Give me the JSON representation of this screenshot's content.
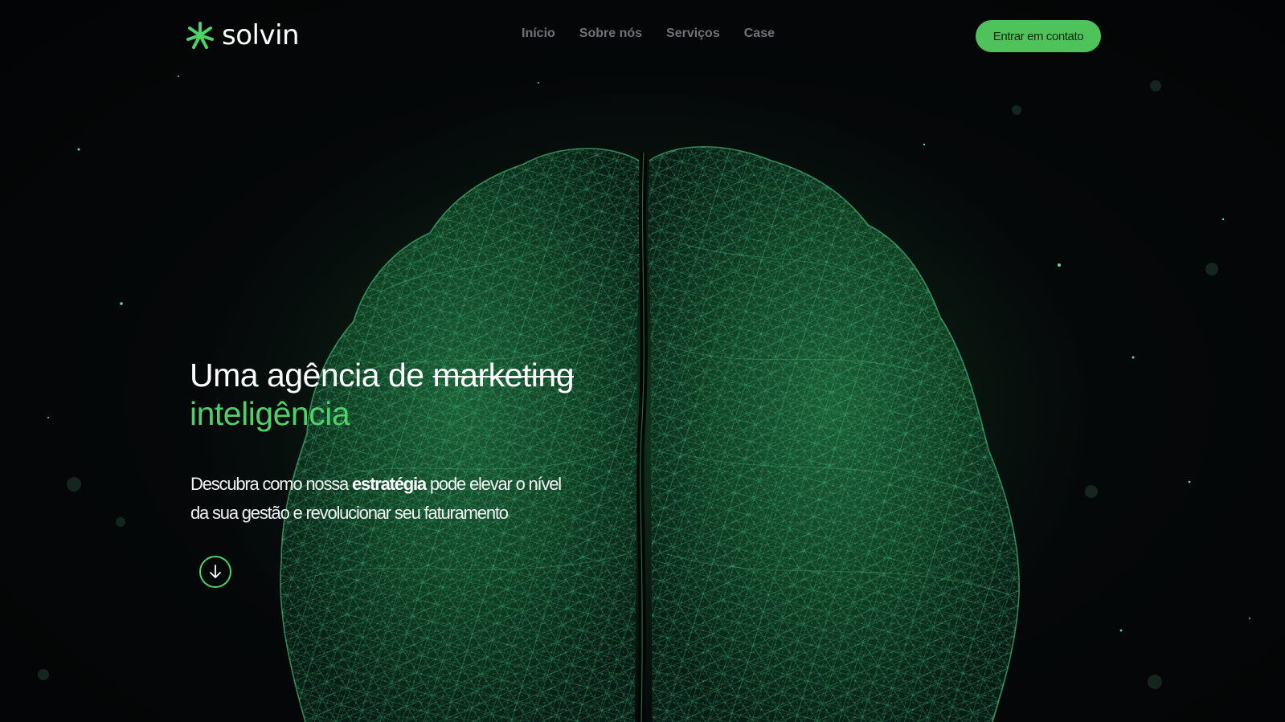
{
  "brand": {
    "name": "solvin",
    "accent_color": "#4fd16a",
    "button_color": "#4fc25a"
  },
  "nav": {
    "items": [
      {
        "label": "Início"
      },
      {
        "label": "Sobre nós"
      },
      {
        "label": "Serviços"
      },
      {
        "label": "Case"
      }
    ],
    "cta_label": "Entrar em contato"
  },
  "hero": {
    "title_prefix": "Uma agência de",
    "title_struck": "marketing",
    "title_accent": "inteligência",
    "subtitle_before": "Descubra como nossa",
    "subtitle_bold": "estratégia",
    "subtitle_after": "pode elevar o nível da sua gestão e revolucionar seu faturamento",
    "scroll_icon": "arrow-down-icon"
  },
  "background": {
    "image": "green-wireframe-brain-illustration"
  }
}
